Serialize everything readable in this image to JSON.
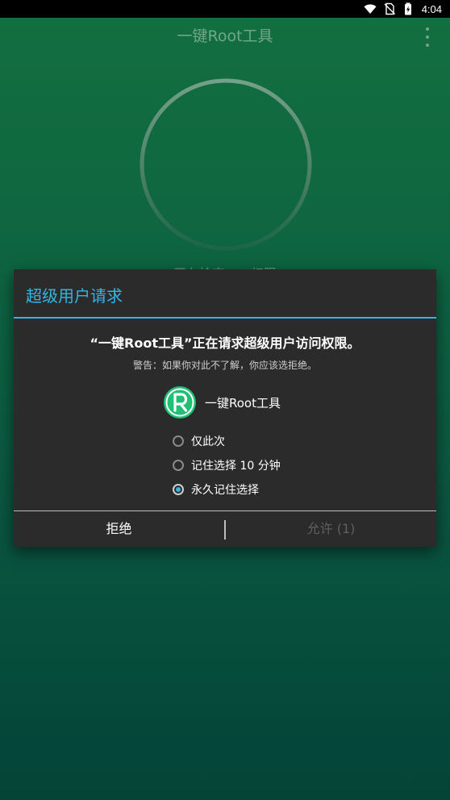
{
  "status_bar": {
    "time": "4:04",
    "icons": [
      "wifi-icon",
      "no-sim-icon",
      "battery-charging-icon"
    ]
  },
  "app_bar": {
    "title": "一键Root工具",
    "menu_icon": "overflow-menu-icon"
  },
  "behind": {
    "status_text": "正在检查root权限"
  },
  "dialog": {
    "title": "超级用户请求",
    "message": "“一键Root工具”正在请求超级用户访问权限。",
    "warning": "警告：如果你对此不了解，你应该选拒绝。",
    "app_name": "一键Root工具",
    "app_logo_letter": "R",
    "options": [
      {
        "label": "仅此次",
        "checked": false
      },
      {
        "label": "记住选择 10 分钟",
        "checked": false
      },
      {
        "label": "永久记住选择",
        "checked": true
      }
    ],
    "deny_label": "拒绝",
    "allow_label": "允许 (1)"
  },
  "colors": {
    "accent": "#33b5e5",
    "dialog_bg": "#2b2b2b",
    "logo_green": "#1fbf74",
    "disabled_text": "#5f5f5f"
  }
}
